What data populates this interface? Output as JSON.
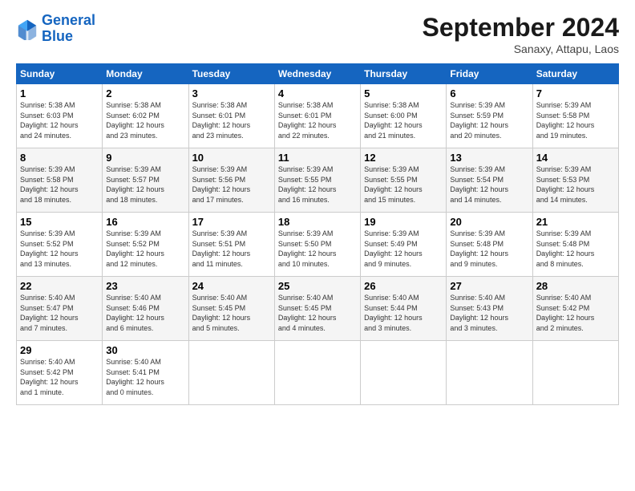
{
  "header": {
    "logo_line1": "General",
    "logo_line2": "Blue",
    "month_title": "September 2024",
    "subtitle": "Sanaxy, Attapu, Laos"
  },
  "weekdays": [
    "Sunday",
    "Monday",
    "Tuesday",
    "Wednesday",
    "Thursday",
    "Friday",
    "Saturday"
  ],
  "weeks": [
    [
      {
        "day": "1",
        "info": "Sunrise: 5:38 AM\nSunset: 6:03 PM\nDaylight: 12 hours\nand 24 minutes."
      },
      {
        "day": "2",
        "info": "Sunrise: 5:38 AM\nSunset: 6:02 PM\nDaylight: 12 hours\nand 23 minutes."
      },
      {
        "day": "3",
        "info": "Sunrise: 5:38 AM\nSunset: 6:01 PM\nDaylight: 12 hours\nand 23 minutes."
      },
      {
        "day": "4",
        "info": "Sunrise: 5:38 AM\nSunset: 6:01 PM\nDaylight: 12 hours\nand 22 minutes."
      },
      {
        "day": "5",
        "info": "Sunrise: 5:38 AM\nSunset: 6:00 PM\nDaylight: 12 hours\nand 21 minutes."
      },
      {
        "day": "6",
        "info": "Sunrise: 5:39 AM\nSunset: 5:59 PM\nDaylight: 12 hours\nand 20 minutes."
      },
      {
        "day": "7",
        "info": "Sunrise: 5:39 AM\nSunset: 5:58 PM\nDaylight: 12 hours\nand 19 minutes."
      }
    ],
    [
      {
        "day": "8",
        "info": "Sunrise: 5:39 AM\nSunset: 5:58 PM\nDaylight: 12 hours\nand 18 minutes."
      },
      {
        "day": "9",
        "info": "Sunrise: 5:39 AM\nSunset: 5:57 PM\nDaylight: 12 hours\nand 18 minutes."
      },
      {
        "day": "10",
        "info": "Sunrise: 5:39 AM\nSunset: 5:56 PM\nDaylight: 12 hours\nand 17 minutes."
      },
      {
        "day": "11",
        "info": "Sunrise: 5:39 AM\nSunset: 5:55 PM\nDaylight: 12 hours\nand 16 minutes."
      },
      {
        "day": "12",
        "info": "Sunrise: 5:39 AM\nSunset: 5:55 PM\nDaylight: 12 hours\nand 15 minutes."
      },
      {
        "day": "13",
        "info": "Sunrise: 5:39 AM\nSunset: 5:54 PM\nDaylight: 12 hours\nand 14 minutes."
      },
      {
        "day": "14",
        "info": "Sunrise: 5:39 AM\nSunset: 5:53 PM\nDaylight: 12 hours\nand 14 minutes."
      }
    ],
    [
      {
        "day": "15",
        "info": "Sunrise: 5:39 AM\nSunset: 5:52 PM\nDaylight: 12 hours\nand 13 minutes."
      },
      {
        "day": "16",
        "info": "Sunrise: 5:39 AM\nSunset: 5:52 PM\nDaylight: 12 hours\nand 12 minutes."
      },
      {
        "day": "17",
        "info": "Sunrise: 5:39 AM\nSunset: 5:51 PM\nDaylight: 12 hours\nand 11 minutes."
      },
      {
        "day": "18",
        "info": "Sunrise: 5:39 AM\nSunset: 5:50 PM\nDaylight: 12 hours\nand 10 minutes."
      },
      {
        "day": "19",
        "info": "Sunrise: 5:39 AM\nSunset: 5:49 PM\nDaylight: 12 hours\nand 9 minutes."
      },
      {
        "day": "20",
        "info": "Sunrise: 5:39 AM\nSunset: 5:48 PM\nDaylight: 12 hours\nand 9 minutes."
      },
      {
        "day": "21",
        "info": "Sunrise: 5:39 AM\nSunset: 5:48 PM\nDaylight: 12 hours\nand 8 minutes."
      }
    ],
    [
      {
        "day": "22",
        "info": "Sunrise: 5:40 AM\nSunset: 5:47 PM\nDaylight: 12 hours\nand 7 minutes."
      },
      {
        "day": "23",
        "info": "Sunrise: 5:40 AM\nSunset: 5:46 PM\nDaylight: 12 hours\nand 6 minutes."
      },
      {
        "day": "24",
        "info": "Sunrise: 5:40 AM\nSunset: 5:45 PM\nDaylight: 12 hours\nand 5 minutes."
      },
      {
        "day": "25",
        "info": "Sunrise: 5:40 AM\nSunset: 5:45 PM\nDaylight: 12 hours\nand 4 minutes."
      },
      {
        "day": "26",
        "info": "Sunrise: 5:40 AM\nSunset: 5:44 PM\nDaylight: 12 hours\nand 3 minutes."
      },
      {
        "day": "27",
        "info": "Sunrise: 5:40 AM\nSunset: 5:43 PM\nDaylight: 12 hours\nand 3 minutes."
      },
      {
        "day": "28",
        "info": "Sunrise: 5:40 AM\nSunset: 5:42 PM\nDaylight: 12 hours\nand 2 minutes."
      }
    ],
    [
      {
        "day": "29",
        "info": "Sunrise: 5:40 AM\nSunset: 5:42 PM\nDaylight: 12 hours\nand 1 minute."
      },
      {
        "day": "30",
        "info": "Sunrise: 5:40 AM\nSunset: 5:41 PM\nDaylight: 12 hours\nand 0 minutes."
      },
      {
        "day": "",
        "info": ""
      },
      {
        "day": "",
        "info": ""
      },
      {
        "day": "",
        "info": ""
      },
      {
        "day": "",
        "info": ""
      },
      {
        "day": "",
        "info": ""
      }
    ]
  ]
}
